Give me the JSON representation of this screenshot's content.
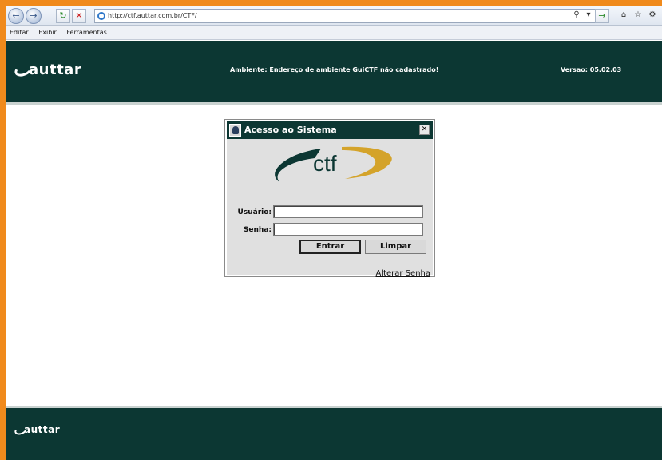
{
  "browser": {
    "url": "http://ctf.auttar.com.br/CTF/",
    "back_icon": "back-arrow-icon",
    "forward_icon": "forward-arrow-icon",
    "menu": [
      "Editar",
      "Exibir",
      "Ferramentas"
    ]
  },
  "header": {
    "logo_text": "auttar",
    "ambiente": "Ambiente: Endereço de ambiente GuiCTF não cadastrado!",
    "versao": "Versao: 05.02.03"
  },
  "dialog": {
    "title": "Acesso ao Sistema",
    "logo_text": "ctf",
    "usuario_label": "Usuário:",
    "usuario_value": "",
    "senha_label": "Senha:",
    "senha_value": "",
    "entrar_label": "Entrar",
    "limpar_label": "Limpar",
    "alterar_senha_label": "Alterar Senha"
  },
  "footer": {
    "logo_text": "auttar"
  },
  "colors": {
    "brand_dark": "#0c3733",
    "ctf_gold": "#d4a32a",
    "window_frame": "#f08a1c"
  }
}
